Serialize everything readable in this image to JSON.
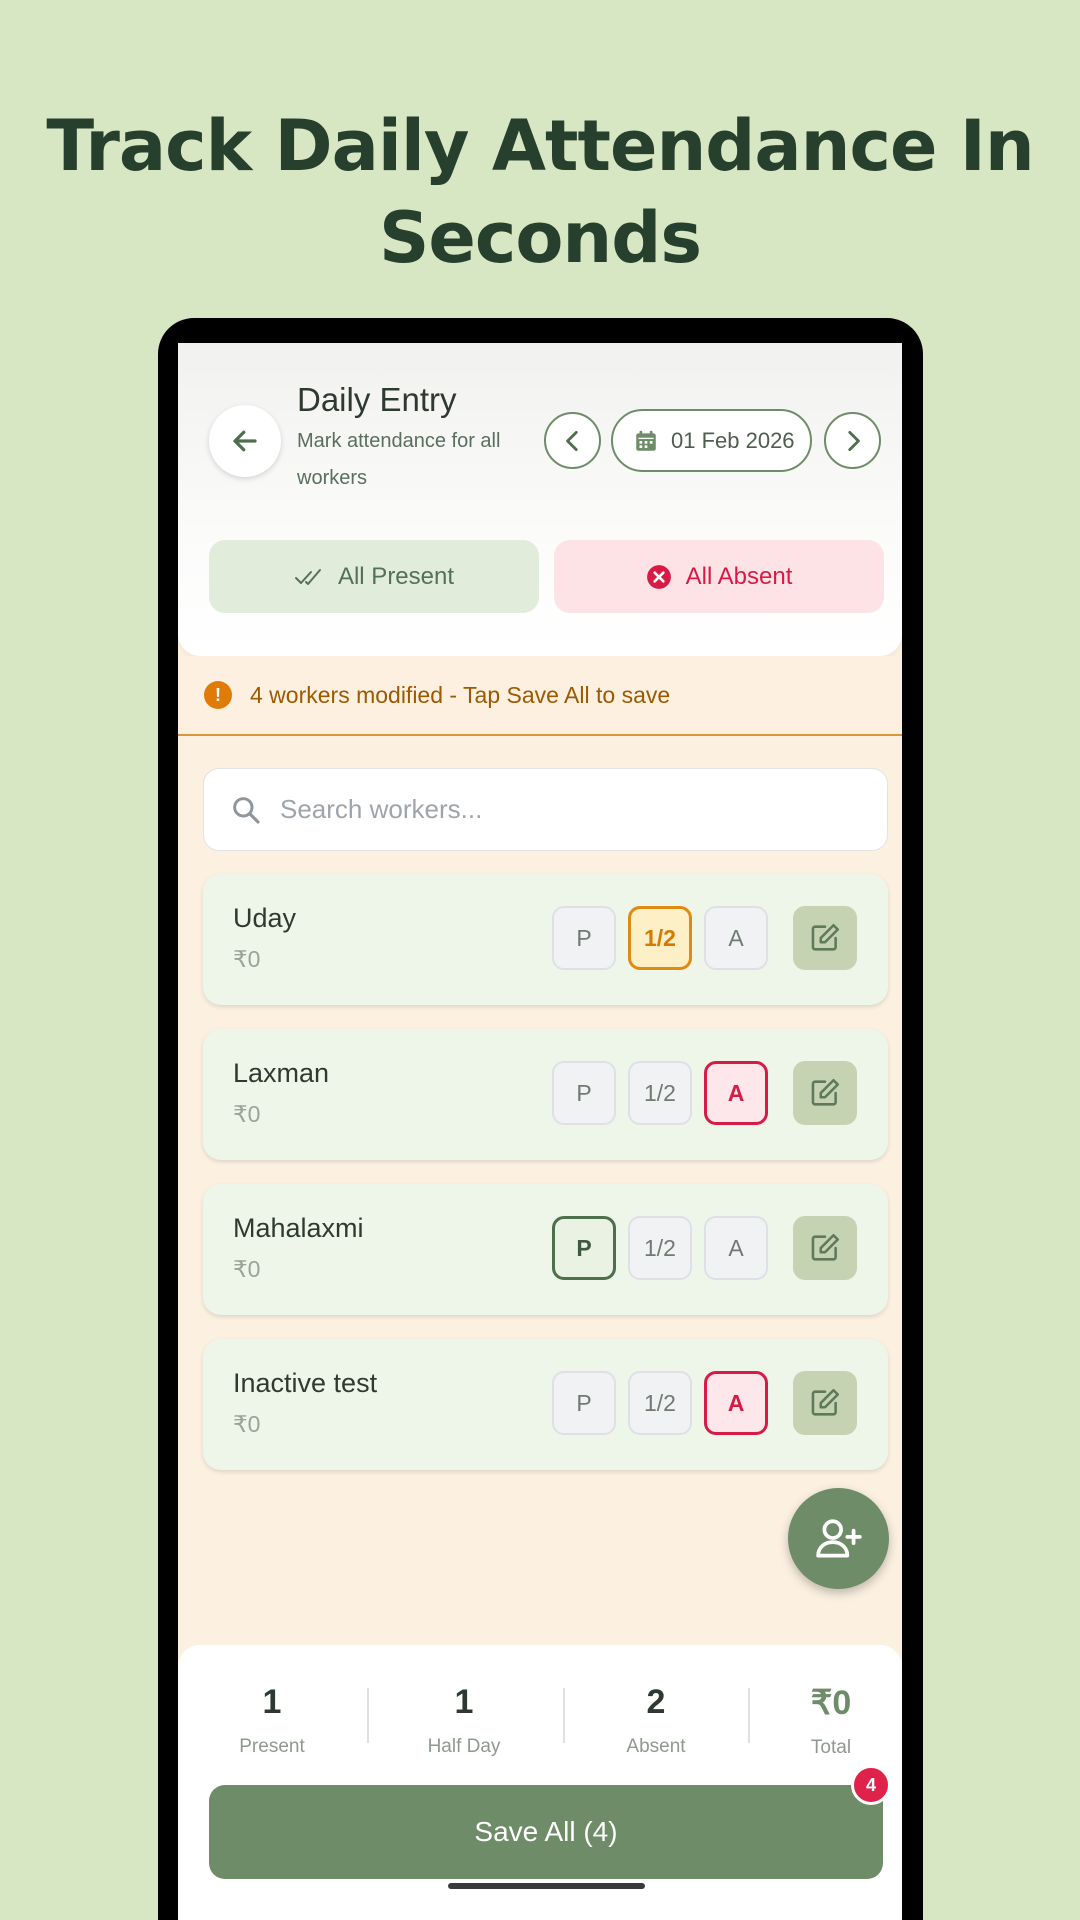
{
  "headline": {
    "line1": "Track Daily Attendance In",
    "line2": "Seconds"
  },
  "header": {
    "title": "Daily Entry",
    "subtitle": "Mark attendance for all workers",
    "date": "01 Feb 2026",
    "icons": {
      "back": "arrow-left-icon",
      "prev": "chevron-left-icon",
      "next": "chevron-right-icon",
      "calendar": "calendar-icon"
    }
  },
  "bulk_actions": {
    "all_present": "All Present",
    "all_absent": "All Absent"
  },
  "banner": {
    "text": "4 workers modified - Tap Save All to save",
    "icon": "warning-icon"
  },
  "search": {
    "placeholder": "Search workers..."
  },
  "option_labels": {
    "present": "P",
    "half": "1/2",
    "absent": "A"
  },
  "workers": [
    {
      "name": "Uday",
      "amount": "₹0",
      "status": "half"
    },
    {
      "name": "Laxman",
      "amount": "₹0",
      "status": "absent"
    },
    {
      "name": "Mahalaxmi",
      "amount": "₹0",
      "status": "present"
    },
    {
      "name": "Inactive test",
      "amount": "₹0",
      "status": "absent"
    }
  ],
  "summary": {
    "present": {
      "value": "1",
      "label": "Present"
    },
    "half_day": {
      "value": "1",
      "label": "Half Day"
    },
    "absent": {
      "value": "2",
      "label": "Absent"
    },
    "total": {
      "value": "₹0",
      "label": "Total"
    }
  },
  "save": {
    "label": "Save All (4)",
    "badge": "4"
  },
  "colors": {
    "background": "#d7e6c3",
    "accent": "#6e8c68",
    "absent": "#d81b45",
    "half": "#e08a12",
    "headline": "#27402e"
  }
}
